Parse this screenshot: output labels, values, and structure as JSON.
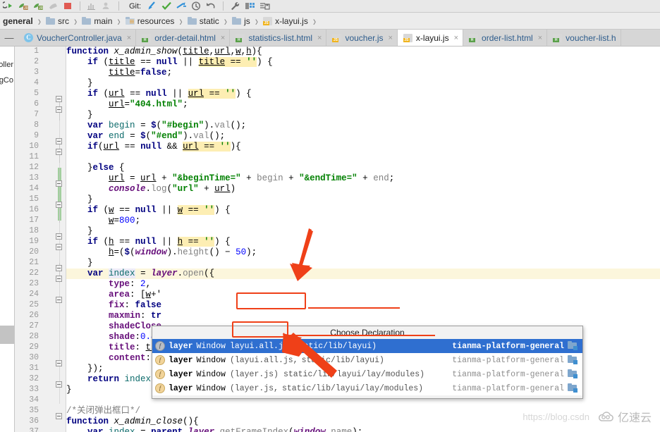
{
  "toolbar": {
    "git_label": "Git:",
    "icons": [
      "debug-icon",
      "run-jar-icon",
      "debug-jar-icon",
      "stop-icon",
      "record-icon",
      "profile-icon",
      "attach-icon",
      "git-update-icon",
      "git-commit-icon",
      "git-push-icon",
      "git-history-icon",
      "git-revert-icon",
      "wrench-icon",
      "structure-icon",
      "save-all-icon"
    ]
  },
  "breadcrumb": {
    "items": [
      {
        "label": "general",
        "icon": "module-icon"
      },
      {
        "label": "src",
        "icon": "folder-icon"
      },
      {
        "label": "main",
        "icon": "folder-icon"
      },
      {
        "label": "resources",
        "icon": "resources-folder-icon"
      },
      {
        "label": "static",
        "icon": "folder-icon"
      },
      {
        "label": "js",
        "icon": "folder-icon"
      },
      {
        "label": "x-layui.js",
        "icon": "js-file-icon"
      }
    ],
    "separator": "›"
  },
  "tabs": {
    "close_glyph": "×",
    "collapse_glyph": "—",
    "items": [
      {
        "label": "VoucherController.java",
        "icon": "java-class-icon",
        "active": false,
        "closable": true
      },
      {
        "label": "order-detail.html",
        "icon": "html-file-icon",
        "active": false,
        "closable": true
      },
      {
        "label": "statistics-list.html",
        "icon": "html-file-icon",
        "active": false,
        "closable": true
      },
      {
        "label": "voucher.js",
        "icon": "js-file-icon",
        "active": false,
        "closable": true
      },
      {
        "label": "x-layui.js",
        "icon": "js-file-icon",
        "active": true,
        "closable": true
      },
      {
        "label": "order-list.html",
        "icon": "html-file-icon",
        "active": false,
        "closable": true
      },
      {
        "label": "voucher-list.h",
        "icon": "html-file-icon",
        "active": false,
        "closable": false
      }
    ]
  },
  "left_panel": {
    "labels": [
      "oller",
      "gCo"
    ]
  },
  "editor": {
    "first_line": 1,
    "last_line": 37,
    "current_line": 22,
    "lines": [
      {
        "n": 1,
        "text": "function x_admin_show(title,url,w,h){"
      },
      {
        "n": 2,
        "text": "    if (title == null || title == '') {"
      },
      {
        "n": 3,
        "text": "        title=false;"
      },
      {
        "n": 4,
        "text": "    }"
      },
      {
        "n": 5,
        "text": "    if (url == null || url == '') {"
      },
      {
        "n": 6,
        "text": "        url=\"404.html\";"
      },
      {
        "n": 7,
        "text": "    }"
      },
      {
        "n": 8,
        "text": "    var begin = $(\"#begin\").val();"
      },
      {
        "n": 9,
        "text": "    var end = $(\"#end\").val();"
      },
      {
        "n": 10,
        "text": "    if(url == null && url == ''){"
      },
      {
        "n": 11,
        "text": ""
      },
      {
        "n": 12,
        "text": "    }else {"
      },
      {
        "n": 13,
        "text": "        url = url + \"&beginTime=\" + begin + \"&endTime=\" + end;"
      },
      {
        "n": 14,
        "text": "        console.log(\"url\" + url)"
      },
      {
        "n": 15,
        "text": "    }"
      },
      {
        "n": 16,
        "text": "    if (w == null || w == '') {"
      },
      {
        "n": 17,
        "text": "        w=800;"
      },
      {
        "n": 18,
        "text": "    }"
      },
      {
        "n": 19,
        "text": "    if (h == null || h == '') {"
      },
      {
        "n": 20,
        "text": "        h=($(window).height() - 50);"
      },
      {
        "n": 21,
        "text": "    }"
      },
      {
        "n": 22,
        "text": "    var index = layer.open({"
      },
      {
        "n": 23,
        "text": "        type: 2,"
      },
      {
        "n": 24,
        "text": "        area: [w+'"
      },
      {
        "n": 25,
        "text": "        fix: false"
      },
      {
        "n": 26,
        "text": "        maxmin: tr"
      },
      {
        "n": 27,
        "text": "        shadeClose"
      },
      {
        "n": 28,
        "text": "        shade:0.4,"
      },
      {
        "n": 29,
        "text": "        title: title,"
      },
      {
        "n": 30,
        "text": "        content: url"
      },
      {
        "n": 31,
        "text": "    });"
      },
      {
        "n": 32,
        "text": "    return index;"
      },
      {
        "n": 33,
        "text": "}"
      },
      {
        "n": 34,
        "text": ""
      },
      {
        "n": 35,
        "text": "/*关闭弹出框口*/"
      },
      {
        "n": 36,
        "text": "function x_admin_close(){"
      },
      {
        "n": 37,
        "text": "    var index = parent.layer.getFrameIndex(window.name);"
      }
    ]
  },
  "popup": {
    "title": "Choose Declaration",
    "rows": [
      {
        "name": "layer",
        "type": "Window",
        "file": "layui.all.js",
        "path": "static/lib/layui)",
        "module": "tianma-platform-general",
        "selected": true,
        "icon": "function-icon"
      },
      {
        "name": "layer",
        "type": "Window",
        "file": "(layui.all.js,",
        "path": "static/lib/layui)",
        "module": "tianma-platform-general",
        "selected": false,
        "icon": "function-icon"
      },
      {
        "name": "layer",
        "type": "Window",
        "file": "(layer.js)",
        "path": "static/lib/layui/lay/modules)",
        "module": "tianma-platform-general",
        "selected": false,
        "icon": "function-icon"
      },
      {
        "name": "layer",
        "type": "Window",
        "file": "(layer.js,",
        "path": "static/lib/layui/lay/modules)",
        "module": "tianma-platform-general",
        "selected": false,
        "icon": "function-icon"
      }
    ]
  },
  "annotations": {
    "accent_color": "#ef4018",
    "arrows": [
      "arrow-to-layui-all-js",
      "arrow-to-layer-js"
    ],
    "highlight_boxes": [
      "layui.all.js",
      "layer.js"
    ],
    "underlines": [
      "static/lib/layui)",
      "static/lib/layui/lay/modules)"
    ]
  },
  "watermark": {
    "url": "https://blog.csdn",
    "brand": "亿速云"
  },
  "colors": {
    "selection_blue": "#2f6fd0",
    "change_bar_green": "#a2cf9e",
    "current_line_yellow": "#fcf6dc",
    "search_highlight": "#fdeeb3"
  }
}
